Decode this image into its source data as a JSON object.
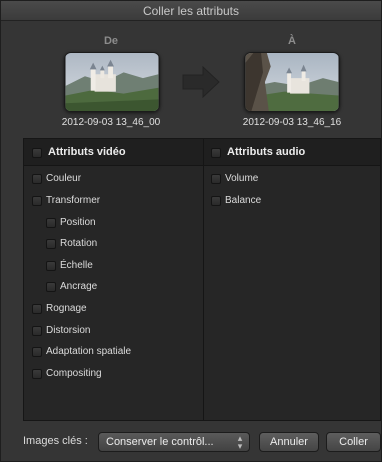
{
  "window": {
    "title": "Coller les attributs"
  },
  "source": {
    "label": "De",
    "date": "2012-09-03 13_46_00",
    "thumbnail_icon": "castle-landscape-thumbnail"
  },
  "destination": {
    "label": "À",
    "date": "2012-09-03 13_46_16",
    "thumbnail_icon": "castle-landscape-thumbnail"
  },
  "arrow_icon": "right-arrow-icon",
  "video": {
    "header": "Attributs vidéo",
    "items": [
      {
        "label": "Couleur",
        "checked": false
      },
      {
        "label": "Transformer",
        "checked": false
      },
      {
        "label": "Position",
        "checked": false
      },
      {
        "label": "Rotation",
        "checked": false
      },
      {
        "label": "Échelle",
        "checked": false
      },
      {
        "label": "Ancrage",
        "checked": false
      },
      {
        "label": "Rognage",
        "checked": false
      },
      {
        "label": "Distorsion",
        "checked": false
      },
      {
        "label": "Adaptation spatiale",
        "checked": false
      },
      {
        "label": "Compositing",
        "checked": false
      }
    ]
  },
  "audio": {
    "header": "Attributs audio",
    "items": [
      {
        "label": "Volume",
        "checked": false
      },
      {
        "label": "Balance",
        "checked": false
      }
    ]
  },
  "footer": {
    "keyframes_label": "Images clés :",
    "keyframes_value": "Conserver le contrôl...",
    "cancel_label": "Annuler",
    "paste_label": "Coller"
  }
}
